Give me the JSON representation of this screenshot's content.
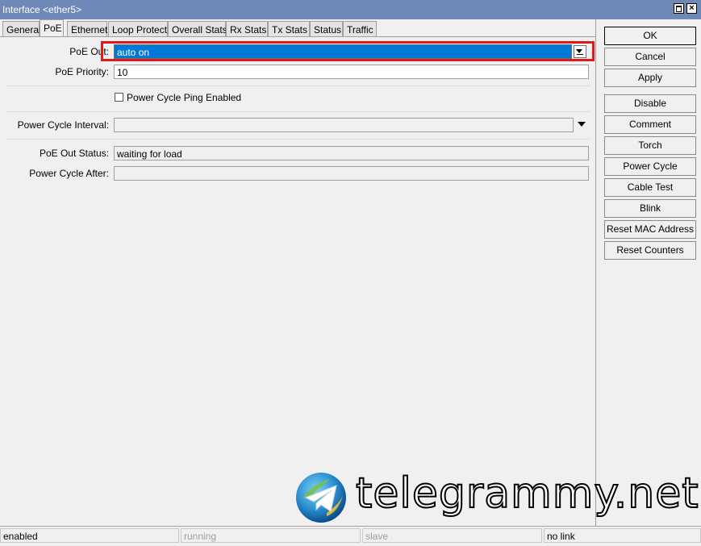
{
  "window": {
    "title": "Interface <ether5>"
  },
  "tabs": [
    {
      "label": "General"
    },
    {
      "label": "PoE"
    },
    {
      "label": "Ethernet"
    },
    {
      "label": "Loop Protect"
    },
    {
      "label": "Overall Stats"
    },
    {
      "label": "Rx Stats"
    },
    {
      "label": "Tx Stats"
    },
    {
      "label": "Status"
    },
    {
      "label": "Traffic"
    }
  ],
  "active_tab": "PoE",
  "form": {
    "poe_out_label": "PoE Out:",
    "poe_out_value": "auto on",
    "poe_priority_label": "PoE Priority:",
    "poe_priority_value": "10",
    "power_cycle_ping_label": "Power Cycle Ping Enabled",
    "power_cycle_ping_checked": false,
    "power_cycle_interval_label": "Power Cycle Interval:",
    "power_cycle_interval_value": "",
    "poe_out_status_label": "PoE Out Status:",
    "poe_out_status_value": "waiting for load",
    "power_cycle_after_label": "Power Cycle After:",
    "power_cycle_after_value": ""
  },
  "buttons": [
    {
      "label": "OK"
    },
    {
      "label": "Cancel"
    },
    {
      "label": "Apply"
    },
    {
      "label": "Disable"
    },
    {
      "label": "Comment"
    },
    {
      "label": "Torch"
    },
    {
      "label": "Power Cycle"
    },
    {
      "label": "Cable Test"
    },
    {
      "label": "Blink"
    },
    {
      "label": "Reset MAC Address"
    },
    {
      "label": "Reset Counters"
    }
  ],
  "status": [
    "enabled",
    "running",
    "slave",
    "no link"
  ],
  "watermark": {
    "text": "telegrammy.net"
  },
  "colors": {
    "titlebar": "#6e88b8",
    "selection": "#0078d7",
    "highlight": "#e0191f"
  },
  "icons": {
    "dropdown": "dropdown-arrow-icon",
    "telegram": "telegram-logo-icon"
  }
}
